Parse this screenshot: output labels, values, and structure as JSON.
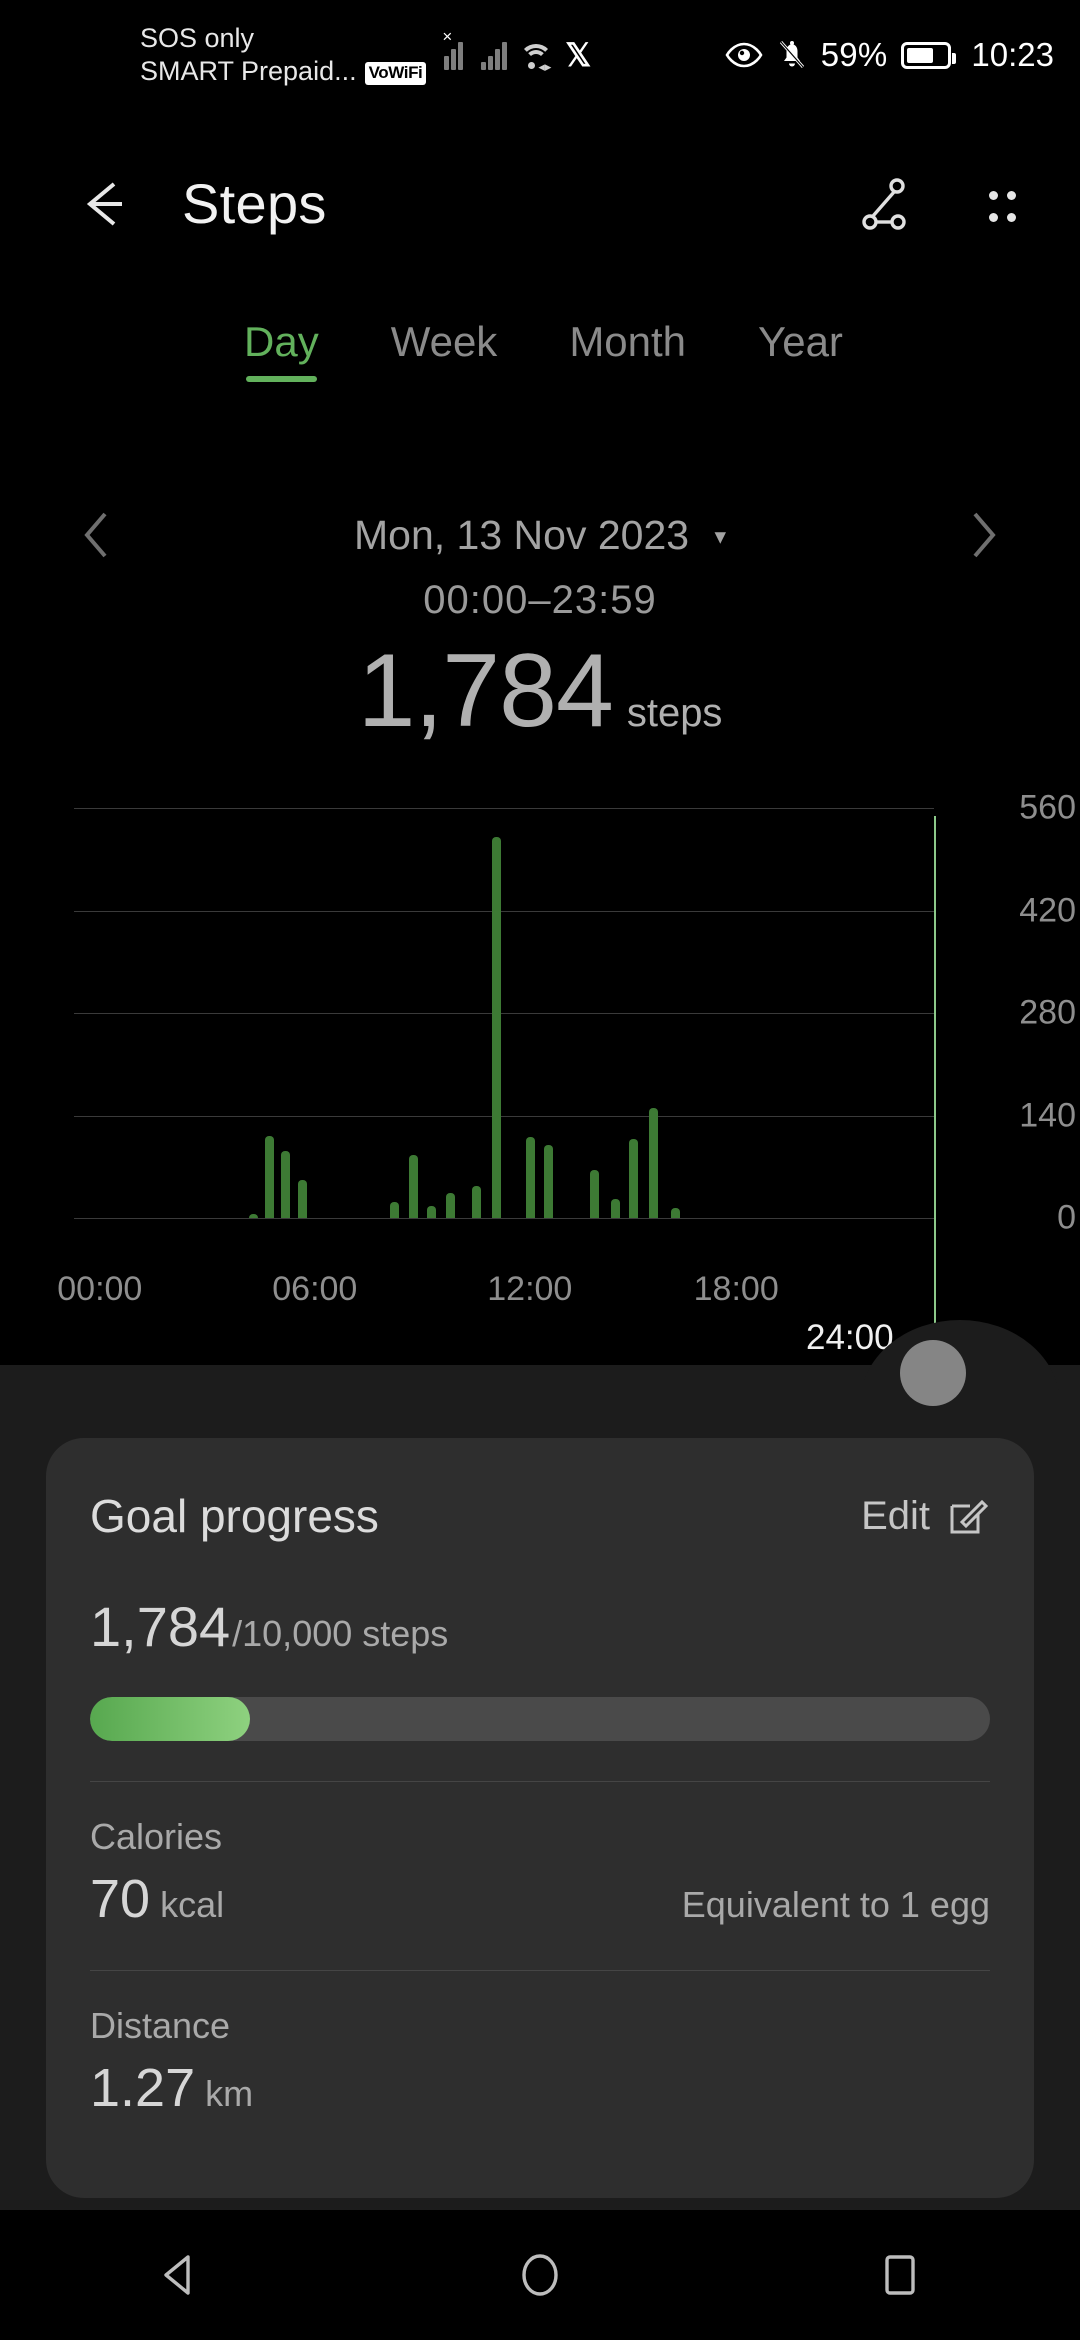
{
  "status_bar": {
    "carrier_line1": "SOS only",
    "carrier_line2": "SMART Prepaid...",
    "vowifi_badge": "VoWiFi",
    "battery_percent": "59%",
    "clock": "10:23",
    "icons": [
      "signal-no-service-icon",
      "signal-icon",
      "wifi-icon",
      "x-app-icon",
      "eye-comfort-icon",
      "mute-bell-icon",
      "battery-icon"
    ]
  },
  "app_bar": {
    "back_label": "back-arrow",
    "title": "Steps",
    "share_label": "share-icon",
    "menu_label": "more-options-icon"
  },
  "tabs": [
    {
      "label": "Day",
      "active": true
    },
    {
      "label": "Week",
      "active": false
    },
    {
      "label": "Month",
      "active": false
    },
    {
      "label": "Year",
      "active": false
    }
  ],
  "date_nav": {
    "prev": "previous-day",
    "next": "next-day",
    "date": "Mon, 13 Nov 2023",
    "caret": "▾"
  },
  "summary": {
    "time_range": "00:00–23:59",
    "total_steps": "1,784",
    "unit": "steps"
  },
  "chart_data": {
    "type": "bar",
    "title": "Steps per interval",
    "xlabel": "",
    "ylabel": "",
    "ylim": [
      0,
      560
    ],
    "yticks": [
      0,
      140,
      280,
      420,
      560
    ],
    "ytick_labels": [
      "0",
      "140",
      "280",
      "420",
      "560"
    ],
    "xticks": [
      "00:00",
      "06:00",
      "12:00",
      "18:00"
    ],
    "xtick_positions_pct": [
      3,
      28,
      53,
      77
    ],
    "grid": true,
    "legend": false,
    "marker": {
      "label": "24:00",
      "position_pct": 100,
      "color": "#8cc98a"
    },
    "bar_color": "#3d7a34",
    "x_range_hours": [
      0,
      24
    ],
    "note": "Each bar is a short time interval during the day. x positions are percent of the 00:00-24:00 span.",
    "points": [
      {
        "x_pct": 20.4,
        "value": 6
      },
      {
        "x_pct": 22.2,
        "value": 112
      },
      {
        "x_pct": 24.1,
        "value": 92
      },
      {
        "x_pct": 26.0,
        "value": 52
      },
      {
        "x_pct": 36.8,
        "value": 22
      },
      {
        "x_pct": 39.0,
        "value": 86
      },
      {
        "x_pct": 41.1,
        "value": 16
      },
      {
        "x_pct": 43.2,
        "value": 34
      },
      {
        "x_pct": 46.3,
        "value": 44
      },
      {
        "x_pct": 48.6,
        "value": 520
      },
      {
        "x_pct": 52.5,
        "value": 110
      },
      {
        "x_pct": 54.6,
        "value": 100
      },
      {
        "x_pct": 60.0,
        "value": 66
      },
      {
        "x_pct": 62.4,
        "value": 26
      },
      {
        "x_pct": 64.5,
        "value": 108
      },
      {
        "x_pct": 66.9,
        "value": 150
      },
      {
        "x_pct": 69.4,
        "value": 14
      }
    ]
  },
  "goal_card": {
    "title": "Goal progress",
    "edit_label": "Edit",
    "edit_icon": "edit-pencil-icon",
    "current": "1,784",
    "target_text": "/10,000",
    "unit": "steps",
    "progress_percent": 17.8,
    "accent_color": "#62b15c",
    "calories": {
      "label": "Calories",
      "value": "70",
      "unit": "kcal",
      "note": "Equivalent to 1 egg"
    },
    "distance": {
      "label": "Distance",
      "value": "1.27",
      "unit": "km"
    }
  },
  "nav_bar": {
    "back": "android-back-icon",
    "home": "android-home-icon",
    "recents": "android-recents-icon"
  }
}
